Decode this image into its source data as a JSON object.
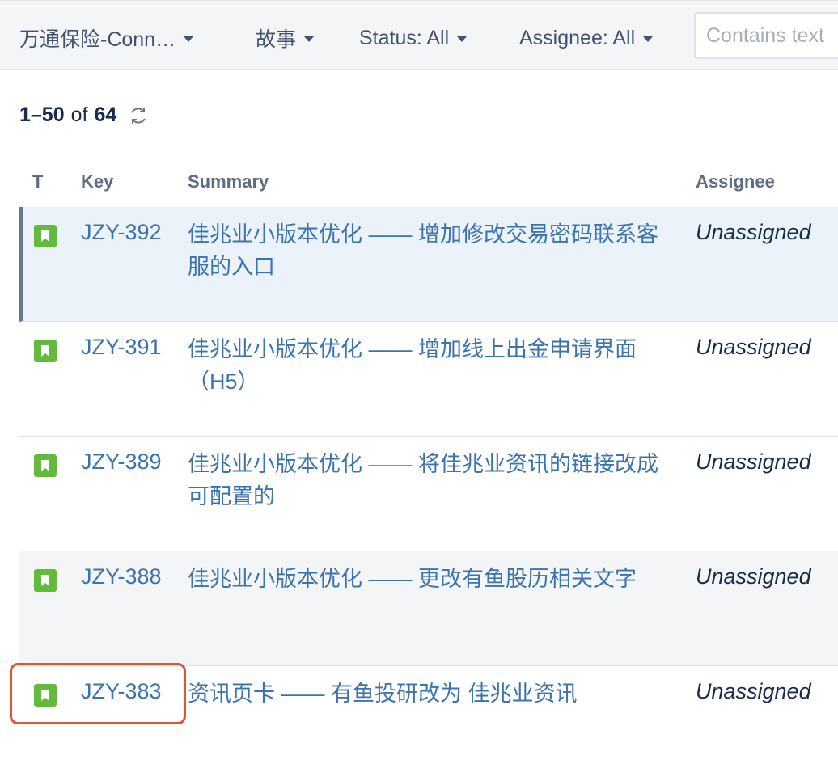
{
  "filters": {
    "project": "万通保险-Conn…",
    "type": "故事",
    "status": "Status: All",
    "assignee": "Assignee: All",
    "search_placeholder": "Contains text"
  },
  "pagination": {
    "range": "1–50",
    "of": "of",
    "total": "64"
  },
  "columns": {
    "type": "T",
    "key": "Key",
    "summary": "Summary",
    "assignee": "Assignee"
  },
  "issues": [
    {
      "icon": "story-icon",
      "key": "JZY-392",
      "summary": "佳兆业小版本优化 —— 增加修改交易密码联系客服的入口",
      "assignee": "Unassigned"
    },
    {
      "icon": "story-icon",
      "key": "JZY-391",
      "summary": "佳兆业小版本优化 —— 增加线上出金申请界面（H5）",
      "assignee": "Unassigned"
    },
    {
      "icon": "story-icon",
      "key": "JZY-389",
      "summary": "佳兆业小版本优化 —— 将佳兆业资讯的链接改成可配置的",
      "assignee": "Unassigned"
    },
    {
      "icon": "story-icon",
      "key": "JZY-388",
      "summary": "佳兆业小版本优化 —— 更改有鱼股历相关文字",
      "assignee": "Unassigned"
    },
    {
      "icon": "story-icon",
      "key": "JZY-383",
      "summary": "资讯页卡 —— 有鱼投研改为 佳兆业资讯",
      "assignee": "Unassigned"
    }
  ],
  "colors": {
    "link": "#3b73af",
    "story_icon": "#63ba3c",
    "highlight": "#e2532e",
    "selected_row": "#ebf2f9"
  }
}
